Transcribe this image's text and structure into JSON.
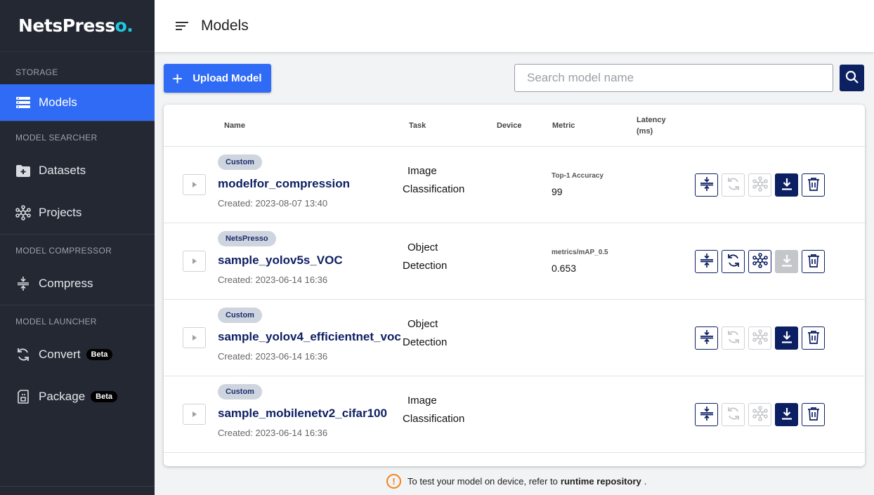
{
  "app": {
    "logo_main": "NetsPress",
    "logo_tail": "o."
  },
  "sidebar": {
    "sections": [
      {
        "title": "STORAGE"
      },
      {
        "title": "MODEL SEARCHER"
      },
      {
        "title": "MODEL COMPRESSOR"
      },
      {
        "title": "MODEL LAUNCHER"
      }
    ],
    "items": [
      {
        "label": "Models",
        "icon": "list-icon",
        "active": true
      },
      {
        "label": "Datasets",
        "icon": "folder-plus-icon"
      },
      {
        "label": "Projects",
        "icon": "network-icon"
      },
      {
        "label": "Compress",
        "icon": "compress-icon"
      },
      {
        "label": "Convert",
        "icon": "sync-icon",
        "badge": "Beta"
      },
      {
        "label": "Package",
        "icon": "package-icon",
        "badge": "Beta"
      }
    ]
  },
  "header": {
    "title": "Models"
  },
  "toolbar": {
    "upload_label": "Upload Model",
    "search_placeholder": "Search model name"
  },
  "table": {
    "columns": {
      "name": "Name",
      "task": "Task",
      "device": "Device",
      "metric": "Metric",
      "latency_l1": "Latency",
      "latency_l2": "(ms)"
    },
    "rows": [
      {
        "tag": "Custom",
        "name": "modelfor_compression",
        "created": "Created: 2023-08-07 13:40",
        "task_l1": "Image",
        "task_l2": "Classification",
        "metric_label": "Top-1 Accuracy",
        "metric_value": "99"
      },
      {
        "tag": "NetsPresso",
        "name": "sample_yolov5s_VOC",
        "created": "Created: 2023-06-14 16:36",
        "task_l1": "Object",
        "task_l2": "Detection",
        "metric_label": "metrics/mAP_0.5",
        "metric_value": "0.653"
      },
      {
        "tag": "Custom",
        "name": "sample_yolov4_efficientnet_voc",
        "created": "Created: 2023-06-14 16:36",
        "task_l1": "Object",
        "task_l2": "Detection",
        "metric_label": "",
        "metric_value": ""
      },
      {
        "tag": "Custom",
        "name": "sample_mobilenetv2_cifar100",
        "created": "Created: 2023-06-14 16:36",
        "task_l1": "Image",
        "task_l2": "Classification",
        "metric_label": "",
        "metric_value": ""
      }
    ]
  },
  "footer": {
    "note_prefix": "To test your model on device, refer to",
    "note_link": "runtime repository",
    "note_suffix": "."
  },
  "colors": {
    "sidebar_bg": "#232833",
    "accent": "#2f6bf5",
    "navy": "#0d1f63",
    "warning": "#f0841c"
  }
}
